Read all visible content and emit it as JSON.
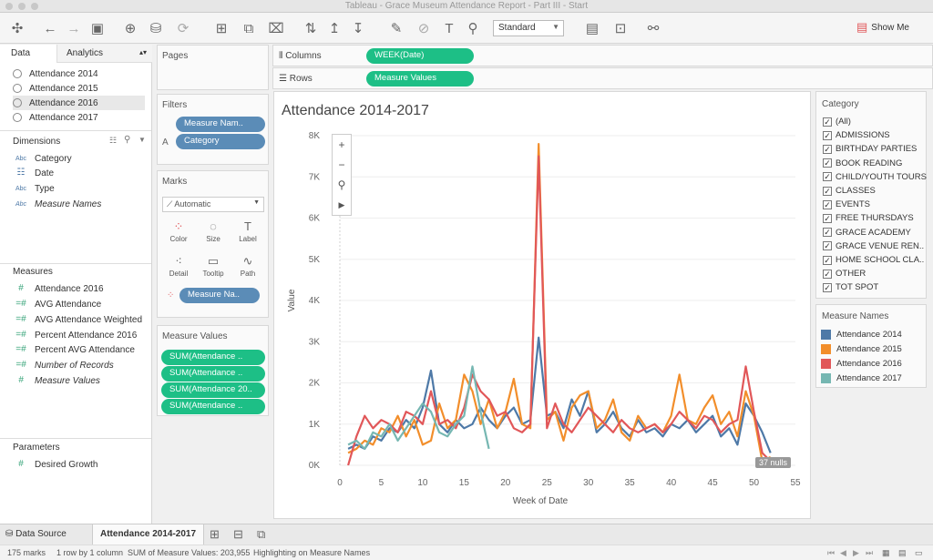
{
  "window": {
    "title": "Tableau - Grace Museum Attendance Report - Part III - Start"
  },
  "toolbar": {
    "view_select": "Standard",
    "show_me": "Show Me"
  },
  "left_pane": {
    "tabs": {
      "data": "Data",
      "analytics": "Analytics"
    },
    "datasources": [
      {
        "label": "Attendance 2014"
      },
      {
        "label": "Attendance 2015"
      },
      {
        "label": "Attendance 2016"
      },
      {
        "label": "Attendance 2017"
      }
    ],
    "dimensions_title": "Dimensions",
    "dimensions": [
      {
        "type": "Abc",
        "label": "Category"
      },
      {
        "type": "cal",
        "label": "Date"
      },
      {
        "type": "Abc",
        "label": "Type"
      },
      {
        "type": "Abc",
        "label": "Measure Names"
      }
    ],
    "measures_title": "Measures",
    "measures": [
      {
        "label": "Attendance 2016"
      },
      {
        "label": "AVG Attendance"
      },
      {
        "label": "AVG Attendance Weighted"
      },
      {
        "label": "Percent Attendance 2016"
      },
      {
        "label": "Percent AVG Attendance"
      },
      {
        "label": "Number of Records"
      },
      {
        "label": "Measure Values"
      }
    ],
    "parameters_title": "Parameters",
    "parameters": [
      {
        "label": "Desired Growth"
      }
    ]
  },
  "cards": {
    "pages": "Pages",
    "filters": "Filters",
    "filter_pills": [
      "Measure Nam..",
      "Category"
    ],
    "marks": "Marks",
    "mark_type": "Automatic",
    "mark_buttons": [
      "Color",
      "Size",
      "Label",
      "Detail",
      "Tooltip",
      "Path"
    ],
    "marks_pill": "Measure Na..",
    "measure_values": "Measure Values",
    "measure_value_pills": [
      "SUM(Attendance ..",
      "SUM(Attendance ..",
      "SUM(Attendance 20..",
      "SUM(Attendance .."
    ]
  },
  "shelves": {
    "columns_label": "Columns",
    "columns_pill": "WEEK(Date)",
    "rows_label": "Rows",
    "rows_pill": "Measure Values"
  },
  "category_filter": {
    "title": "Category",
    "items": [
      "(All)",
      "ADMISSIONS",
      "BIRTHDAY PARTIES",
      "BOOK READING",
      "CHILD/YOUTH TOURS",
      "CLASSES",
      "EVENTS",
      "FREE THURSDAYS",
      "GRACE ACADEMY",
      "GRACE VENUE REN..",
      "HOME SCHOOL CLA..",
      "OTHER",
      "TOT SPOT"
    ]
  },
  "legend": {
    "title": "Measure Names",
    "items": [
      {
        "label": "Attendance 2014",
        "color": "#4e79a7"
      },
      {
        "label": "Attendance 2015",
        "color": "#f28e2b"
      },
      {
        "label": "Attendance 2016",
        "color": "#e15759"
      },
      {
        "label": "Attendance 2017",
        "color": "#76b7b2"
      }
    ]
  },
  "chart_data": {
    "type": "line",
    "title": "Attendance 2014-2017",
    "xlabel": "Week of Date",
    "ylabel": "Value",
    "xlim": [
      0,
      55
    ],
    "ylim": [
      0,
      8000
    ],
    "x_ticks": [
      "0",
      "5",
      "10",
      "15",
      "20",
      "25",
      "30",
      "35",
      "40",
      "45",
      "50",
      "55"
    ],
    "y_ticks": [
      "0K",
      "1K",
      "2K",
      "3K",
      "4K",
      "5K",
      "6K",
      "7K",
      "8K"
    ],
    "nulls_badge": "37 nulls",
    "series": [
      {
        "name": "Attendance 2014",
        "color": "#4e79a7",
        "x": [
          1,
          2,
          3,
          4,
          5,
          6,
          7,
          8,
          9,
          10,
          11,
          12,
          13,
          14,
          15,
          16,
          17,
          18,
          19,
          20,
          21,
          22,
          23,
          24,
          25,
          26,
          27,
          28,
          29,
          30,
          31,
          32,
          33,
          34,
          35,
          36,
          37,
          38,
          39,
          40,
          41,
          42,
          43,
          44,
          45,
          46,
          47,
          48,
          49,
          50,
          51,
          52
        ],
        "values": [
          400,
          500,
          400,
          700,
          600,
          900,
          800,
          1100,
          900,
          1400,
          2300,
          1000,
          800,
          1100,
          900,
          1000,
          1400,
          1100,
          900,
          1200,
          1400,
          1000,
          1100,
          3100,
          1200,
          1300,
          900,
          1600,
          1200,
          1800,
          800,
          1000,
          1300,
          900,
          700,
          1100,
          800,
          900,
          700,
          1000,
          900,
          1100,
          800,
          1000,
          1200,
          700,
          900,
          500,
          1500,
          1200,
          800,
          300
        ]
      },
      {
        "name": "Attendance 2015",
        "color": "#f28e2b",
        "x": [
          1,
          2,
          3,
          4,
          5,
          6,
          7,
          8,
          9,
          10,
          11,
          12,
          13,
          14,
          15,
          16,
          17,
          18,
          19,
          20,
          21,
          22,
          23,
          24,
          25,
          26,
          27,
          28,
          29,
          30,
          31,
          32,
          33,
          34,
          35,
          36,
          37,
          38,
          39,
          40,
          41,
          42,
          43,
          44,
          45,
          46,
          47,
          48,
          49,
          50,
          51,
          52
        ],
        "values": [
          300,
          400,
          600,
          500,
          900,
          800,
          1200,
          700,
          1100,
          500,
          600,
          1500,
          900,
          1100,
          2200,
          1800,
          1000,
          1600,
          900,
          1300,
          2100,
          1000,
          900,
          7800,
          1100,
          1300,
          600,
          1400,
          1700,
          1800,
          900,
          1100,
          1600,
          800,
          600,
          1200,
          900,
          1000,
          800,
          1200,
          2200,
          1100,
          1000,
          1400,
          1700,
          1000,
          1300,
          700,
          1800,
          1200,
          100,
          200
        ]
      },
      {
        "name": "Attendance 2016",
        "color": "#e15759",
        "x": [
          1,
          2,
          3,
          4,
          5,
          6,
          7,
          8,
          9,
          10,
          11,
          12,
          13,
          14,
          15,
          16,
          17,
          18,
          19,
          20,
          21,
          22,
          23,
          24,
          25,
          26,
          27,
          28,
          29,
          30,
          31,
          32,
          33,
          34,
          35,
          36,
          37,
          38,
          39,
          40,
          41,
          42,
          43,
          44,
          45,
          46,
          47,
          48,
          49,
          50,
          51,
          52
        ],
        "values": [
          0,
          700,
          1200,
          900,
          1100,
          1000,
          800,
          1300,
          1200,
          1000,
          1800,
          1000,
          1100,
          900,
          1400,
          2200,
          1800,
          1600,
          1200,
          1300,
          900,
          800,
          1000,
          7500,
          900,
          1500,
          1000,
          800,
          1100,
          1400,
          1200,
          1000,
          800,
          1100,
          900,
          800,
          900,
          1000,
          800,
          1000,
          1300,
          1100,
          900,
          1200,
          1100,
          800,
          1000,
          1100,
          2400,
          1300,
          300,
          100
        ]
      },
      {
        "name": "Attendance 2017",
        "color": "#76b7b2",
        "x": [
          1,
          2,
          3,
          4,
          5,
          6,
          7,
          8,
          9,
          10,
          11,
          12,
          13,
          14,
          15,
          16,
          17,
          18
        ],
        "values": [
          500,
          600,
          400,
          800,
          700,
          1000,
          600,
          900,
          1200,
          1500,
          1300,
          800,
          700,
          1000,
          1200,
          2400,
          1300,
          400
        ]
      }
    ]
  },
  "bottom_tabs": {
    "data_source": "Data Source",
    "sheet": "Attendance 2014-2017"
  },
  "status": {
    "marks": "175 marks",
    "rows_cols": "1 row by 1 column",
    "sum": "SUM of Measure Values: 203,955",
    "highlight": "Highlighting on Measure Names"
  }
}
